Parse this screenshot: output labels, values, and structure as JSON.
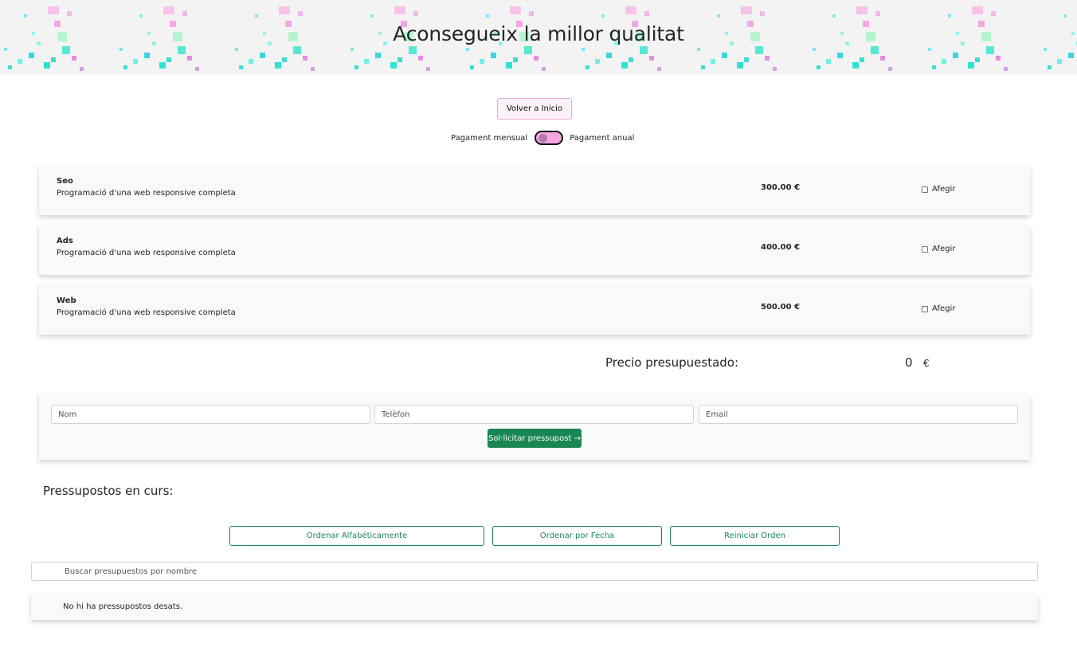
{
  "header": {
    "title": "Aconsegueix la millor qualitat"
  },
  "nav": {
    "home_label": "Volver a Inicio"
  },
  "billing": {
    "monthly_label": "Pagament mensual",
    "annual_label": "Pagament anual",
    "annual_selected": false
  },
  "services": [
    {
      "name": "Seo",
      "description": "Programació d'una web responsive completa",
      "price": "300.00 €",
      "add_label": "Afegir",
      "checked": false
    },
    {
      "name": "Ads",
      "description": "Programació d'una web responsive completa",
      "price": "400.00 €",
      "add_label": "Afegir",
      "checked": false
    },
    {
      "name": "Web",
      "description": "Programació d'una web responsive completa",
      "price": "500.00 €",
      "add_label": "Afegir",
      "checked": false
    }
  ],
  "total": {
    "label": "Precio presupuestado:",
    "value": "0",
    "currency": "€"
  },
  "form": {
    "name_placeholder": "Nom",
    "phone_placeholder": "Telèfon",
    "email_placeholder": "Email",
    "submit_label": "Sol·licitar pressupost →"
  },
  "budgets": {
    "title": "Pressupostos en curs:",
    "sort_alpha_label": "Ordenar Alfabéticamente",
    "sort_date_label": "Ordenar por Fecha",
    "reset_label": "Reiniciar Orden",
    "search_placeholder": "Buscar presupuestos por nombre",
    "empty_message": "No hi ha pressupostos desats."
  },
  "colors": {
    "primary_green": "#198754",
    "toggle_pink": "#f5a6df",
    "card_bg": "#f8f9fa"
  }
}
